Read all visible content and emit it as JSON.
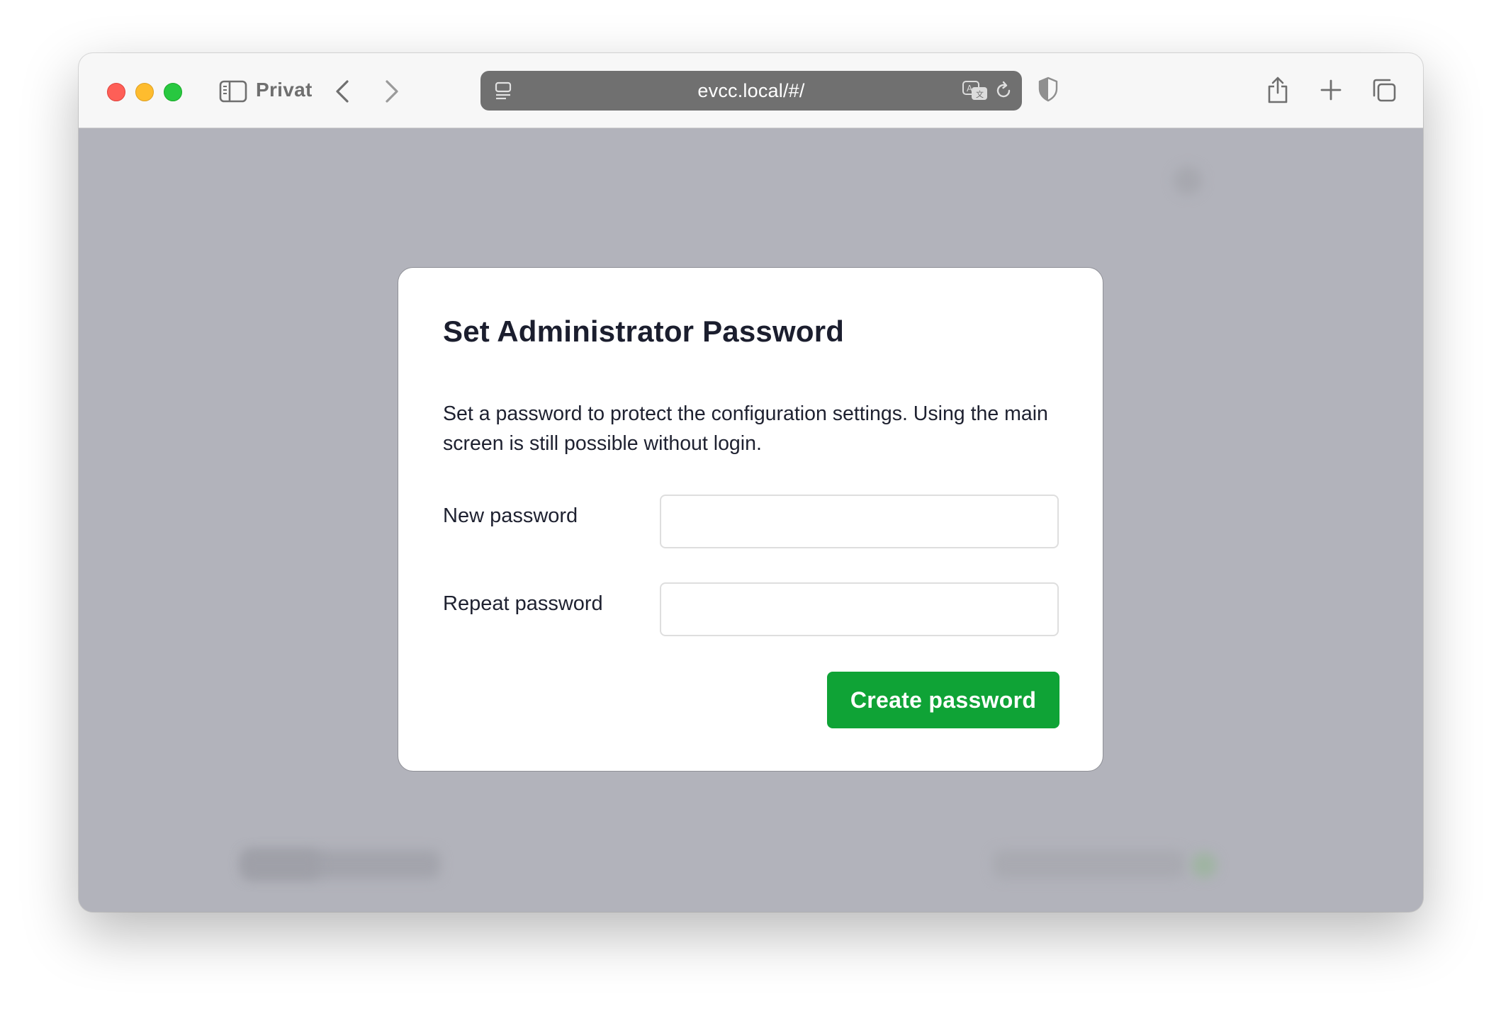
{
  "browser": {
    "private_label": "Privat",
    "url": "evcc.local/#/",
    "icons": {
      "sidebar": "sidebar-icon",
      "back": "chevron-left-icon",
      "forward": "chevron-right-icon",
      "page": "page-menu-icon",
      "translate": "translate-icon",
      "reload": "reload-icon",
      "privacy": "shield-icon",
      "share": "share-icon",
      "new_tab": "plus-icon",
      "tabs": "tab-overview-icon"
    }
  },
  "dialog": {
    "title": "Set Administrator Password",
    "description": "Set a password to protect the configuration settings. Using the main screen is still possible without login.",
    "fields": [
      {
        "label": "New password",
        "value": "",
        "placeholder": ""
      },
      {
        "label": "Repeat password",
        "value": "",
        "placeholder": ""
      }
    ],
    "submit_label": "Create password"
  },
  "colors": {
    "accent": "#0fa336",
    "overlay": "#b2b3bb",
    "address_bar": "#707070"
  }
}
